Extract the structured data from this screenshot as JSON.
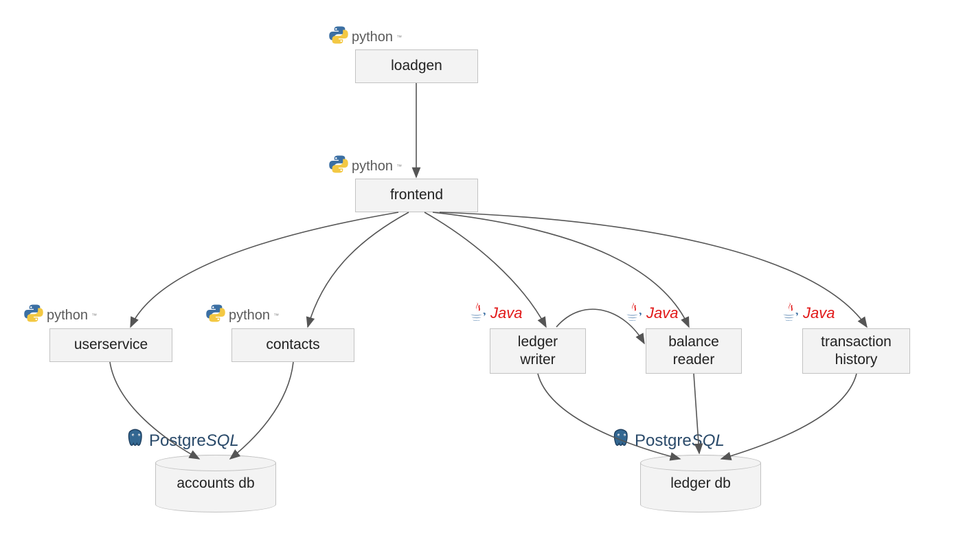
{
  "nodes": {
    "loadgen": {
      "label": "loadgen",
      "tech": "python"
    },
    "frontend": {
      "label": "frontend",
      "tech": "python"
    },
    "userservice": {
      "label": "userservice",
      "tech": "python"
    },
    "contacts": {
      "label": "contacts",
      "tech": "python"
    },
    "ledger_writer": {
      "label": "ledger\nwriter",
      "tech": "java"
    },
    "balance_reader": {
      "label": "balance\nreader",
      "tech": "java"
    },
    "transaction_history": {
      "label": "transaction\nhistory",
      "tech": "java"
    },
    "accounts_db": {
      "label": "accounts db",
      "tech": "postgresql"
    },
    "ledger_db": {
      "label": "ledger db",
      "tech": "postgresql"
    }
  },
  "tech": {
    "python_label": "python",
    "java_label": "Java",
    "postgresql_label_pre": "Postgre",
    "postgresql_label_suf": "SQL"
  },
  "edges": [
    [
      "loadgen",
      "frontend"
    ],
    [
      "frontend",
      "userservice"
    ],
    [
      "frontend",
      "contacts"
    ],
    [
      "frontend",
      "ledger_writer"
    ],
    [
      "frontend",
      "balance_reader"
    ],
    [
      "frontend",
      "transaction_history"
    ],
    [
      "ledger_writer",
      "balance_reader"
    ],
    [
      "userservice",
      "accounts_db"
    ],
    [
      "contacts",
      "accounts_db"
    ],
    [
      "ledger_writer",
      "ledger_db"
    ],
    [
      "balance_reader",
      "ledger_db"
    ],
    [
      "transaction_history",
      "ledger_db"
    ]
  ]
}
